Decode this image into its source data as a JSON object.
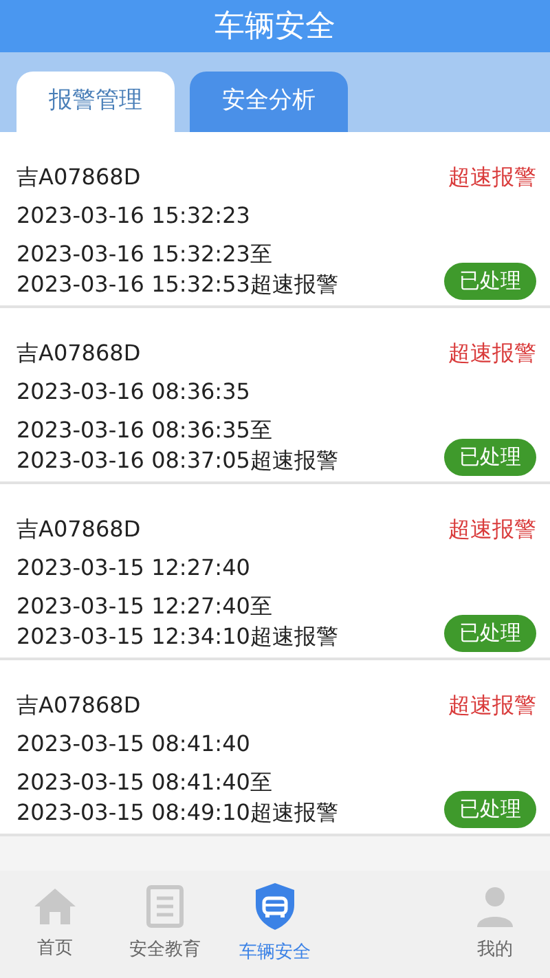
{
  "header": {
    "title": "车辆安全"
  },
  "tabs": [
    {
      "label": "报警管理",
      "selected": true
    },
    {
      "label": "安全分析",
      "selected": false
    }
  ],
  "alarms": [
    {
      "plate": "吉A07868D",
      "type": "超速报警",
      "time": "2023-03-16 15:32:23",
      "detail_line_1": "2023-03-16 15:32:23至",
      "detail_line_2": "2023-03-16 15:32:53超速报警",
      "status": "已处理"
    },
    {
      "plate": "吉A07868D",
      "type": "超速报警",
      "time": "2023-03-16 08:36:35",
      "detail_line_1": "2023-03-16 08:36:35至",
      "detail_line_2": "2023-03-16 08:37:05超速报警",
      "status": "已处理"
    },
    {
      "plate": "吉A07868D",
      "type": "超速报警",
      "time": "2023-03-15 12:27:40",
      "detail_line_1": "2023-03-15 12:27:40至",
      "detail_line_2": "2023-03-15 12:34:10超速报警",
      "status": "已处理"
    },
    {
      "plate": "吉A07868D",
      "type": "超速报警",
      "time": "2023-03-15 08:41:40",
      "detail_line_1": "2023-03-15 08:41:40至",
      "detail_line_2": "2023-03-15 08:49:10超速报警",
      "status": "已处理"
    }
  ],
  "bottom_nav": [
    {
      "label": "首页",
      "kind": "home",
      "selected": false
    },
    {
      "label": "安全教育",
      "kind": "education",
      "selected": false
    },
    {
      "label": "车辆安全",
      "kind": "vehicle",
      "selected": true
    },
    {
      "label": "我的",
      "kind": "profile",
      "selected": false
    }
  ]
}
